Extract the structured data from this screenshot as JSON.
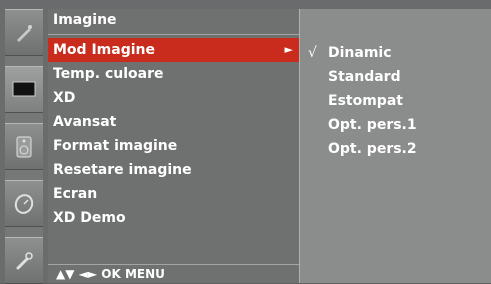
{
  "menu": {
    "title": "Imagine",
    "items": [
      {
        "label": "Mod Imagine",
        "selected": true,
        "has_submenu": true
      },
      {
        "label": "Temp. culoare"
      },
      {
        "label": "XD"
      },
      {
        "label": "Avansat"
      },
      {
        "label": "Format imagine"
      },
      {
        "label": "Resetare imagine"
      },
      {
        "label": "Ecran"
      },
      {
        "label": "XD Demo"
      }
    ],
    "submenu_arrow": "►",
    "nav_hint": "▲▼ ◄► OK MENU"
  },
  "submenu": {
    "checked_mark": "√",
    "options": [
      "Dinamic",
      "Standard",
      "Estompat",
      "Opt. pers.1",
      "Opt. pers.2"
    ]
  },
  "colors": {
    "selected": "#c92c1d",
    "panel": "#6f7070",
    "submenu": "#8b8c8c"
  },
  "sidebar_icons": [
    "picture-icon",
    "screen-icon",
    "speaker-icon",
    "clock-icon",
    "settings-icon"
  ]
}
